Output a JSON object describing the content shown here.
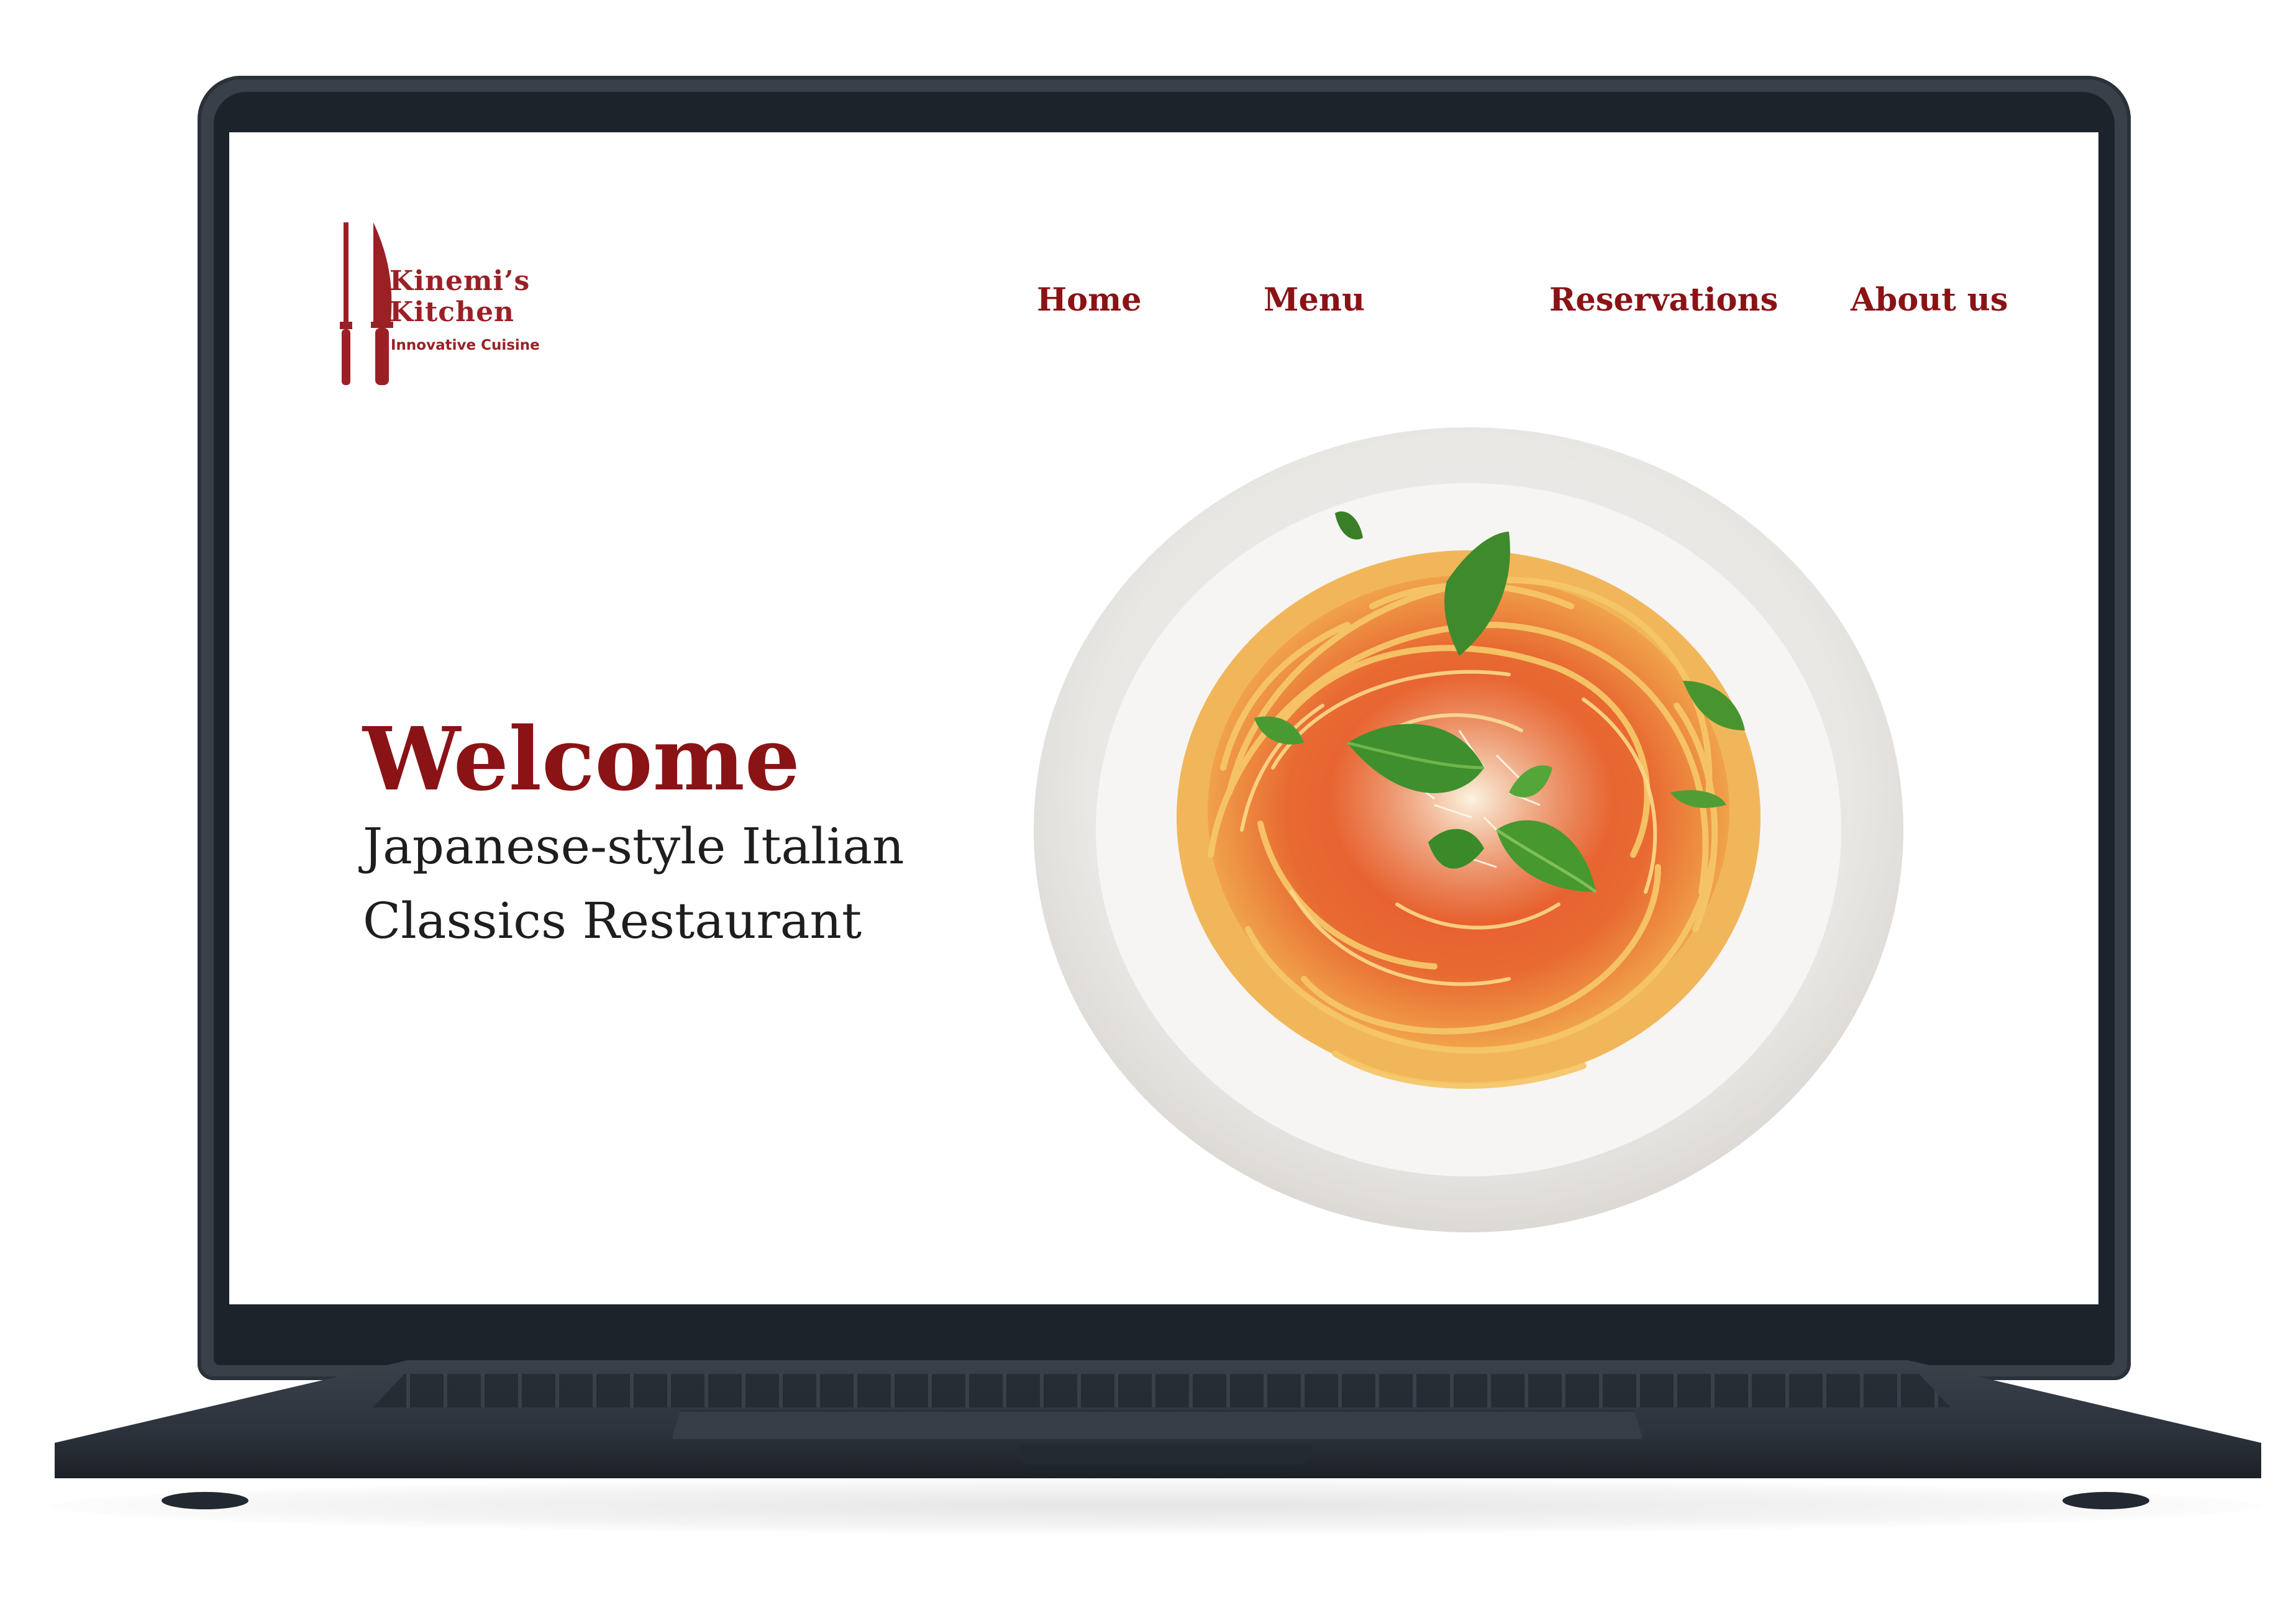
{
  "brand": {
    "name_line1": "Kinemi’s",
    "name_line2": "Kitchen",
    "tagline": "Innovative Cuisine"
  },
  "nav": {
    "items": [
      {
        "label": "Home"
      },
      {
        "label": "Menu"
      },
      {
        "label": "Reservations"
      },
      {
        "label": "About us"
      }
    ]
  },
  "hero": {
    "title": "Welcome",
    "subtitle_line1": "Japanese-style Italian",
    "subtitle_line2": "Classics Restaurant"
  },
  "colors": {
    "brand_red": "#8a1316",
    "logo_red": "#9b2026",
    "text_dark": "#1e1e1e",
    "laptop_frame": "#394049"
  },
  "icons": {
    "logo_knives": "knife-icon",
    "dish_image": "spaghetti-plate-image"
  }
}
